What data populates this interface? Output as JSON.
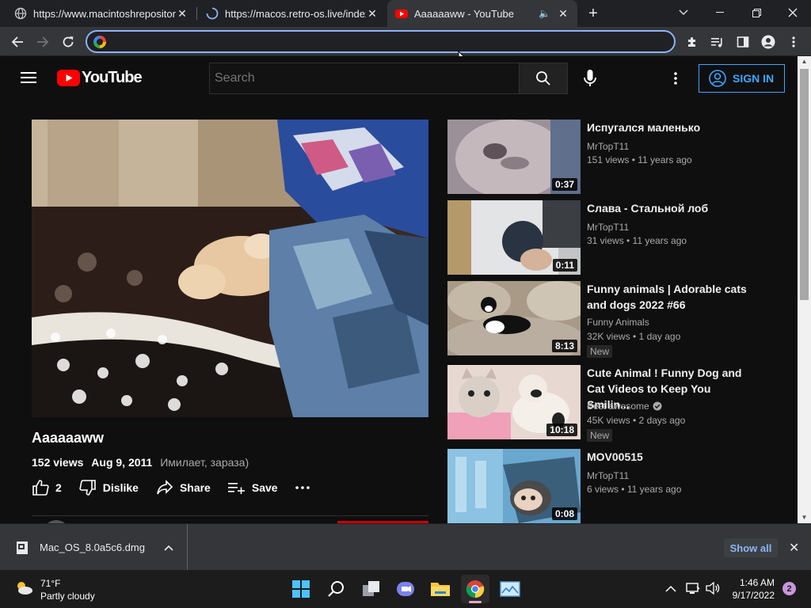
{
  "browser": {
    "tabs": [
      {
        "title": "https://www.macintoshrepository",
        "active": false
      },
      {
        "title": "https://macos.retro-os.live/index",
        "active": false
      },
      {
        "title": "Aaaaaaww - YouTube",
        "active": true
      }
    ],
    "omnibox_value": ""
  },
  "youtube": {
    "logo_text": "YouTube",
    "search_placeholder": "Search",
    "sign_in": "SIGN IN",
    "video": {
      "title": "Aaaaaaww",
      "views": "152 views",
      "date": "Aug 9, 2011",
      "description": "Имилает, зараза)",
      "likes": "2",
      "dislike_label": "Dislike",
      "share_label": "Share",
      "save_label": "Save"
    },
    "recommendations": [
      {
        "title": "Испугался маленько",
        "channel": "MrTopT11",
        "meta": "151 views • 11 years ago",
        "duration": "0:37",
        "badge": "",
        "verified": false
      },
      {
        "title": "Слава - Стальной лоб",
        "channel": "MrTopT11",
        "meta": "31 views • 11 years ago",
        "duration": "0:11",
        "badge": "",
        "verified": false
      },
      {
        "title": "Funny animals | Adorable cats and dogs 2022 #66",
        "channel": "Funny Animals",
        "meta": "32K views • 1 day ago",
        "duration": "8:13",
        "badge": "New",
        "verified": false
      },
      {
        "title": "Cute Animal ! Funny Dog and Cat Videos to Keep You Smilin...",
        "channel": "Best awesome",
        "meta": "45K views • 2 days ago",
        "duration": "10:18",
        "badge": "New",
        "verified": true
      },
      {
        "title": "MOV00515",
        "channel": "MrTopT11",
        "meta": "6 views • 11 years ago",
        "duration": "0:08",
        "badge": "",
        "verified": false
      }
    ]
  },
  "downloads": {
    "file": "Mac_OS_8.0a5c6.dmg",
    "show_all": "Show all"
  },
  "taskbar": {
    "temperature": "71°F",
    "weather": "Partly cloudy",
    "time": "1:46 AM",
    "date": "9/17/2022",
    "notifications": "2"
  },
  "colors": {
    "accent_blue": "#3ea6ff",
    "youtube_red": "#ff0000",
    "omnibox_focus": "#8ab4f8"
  }
}
